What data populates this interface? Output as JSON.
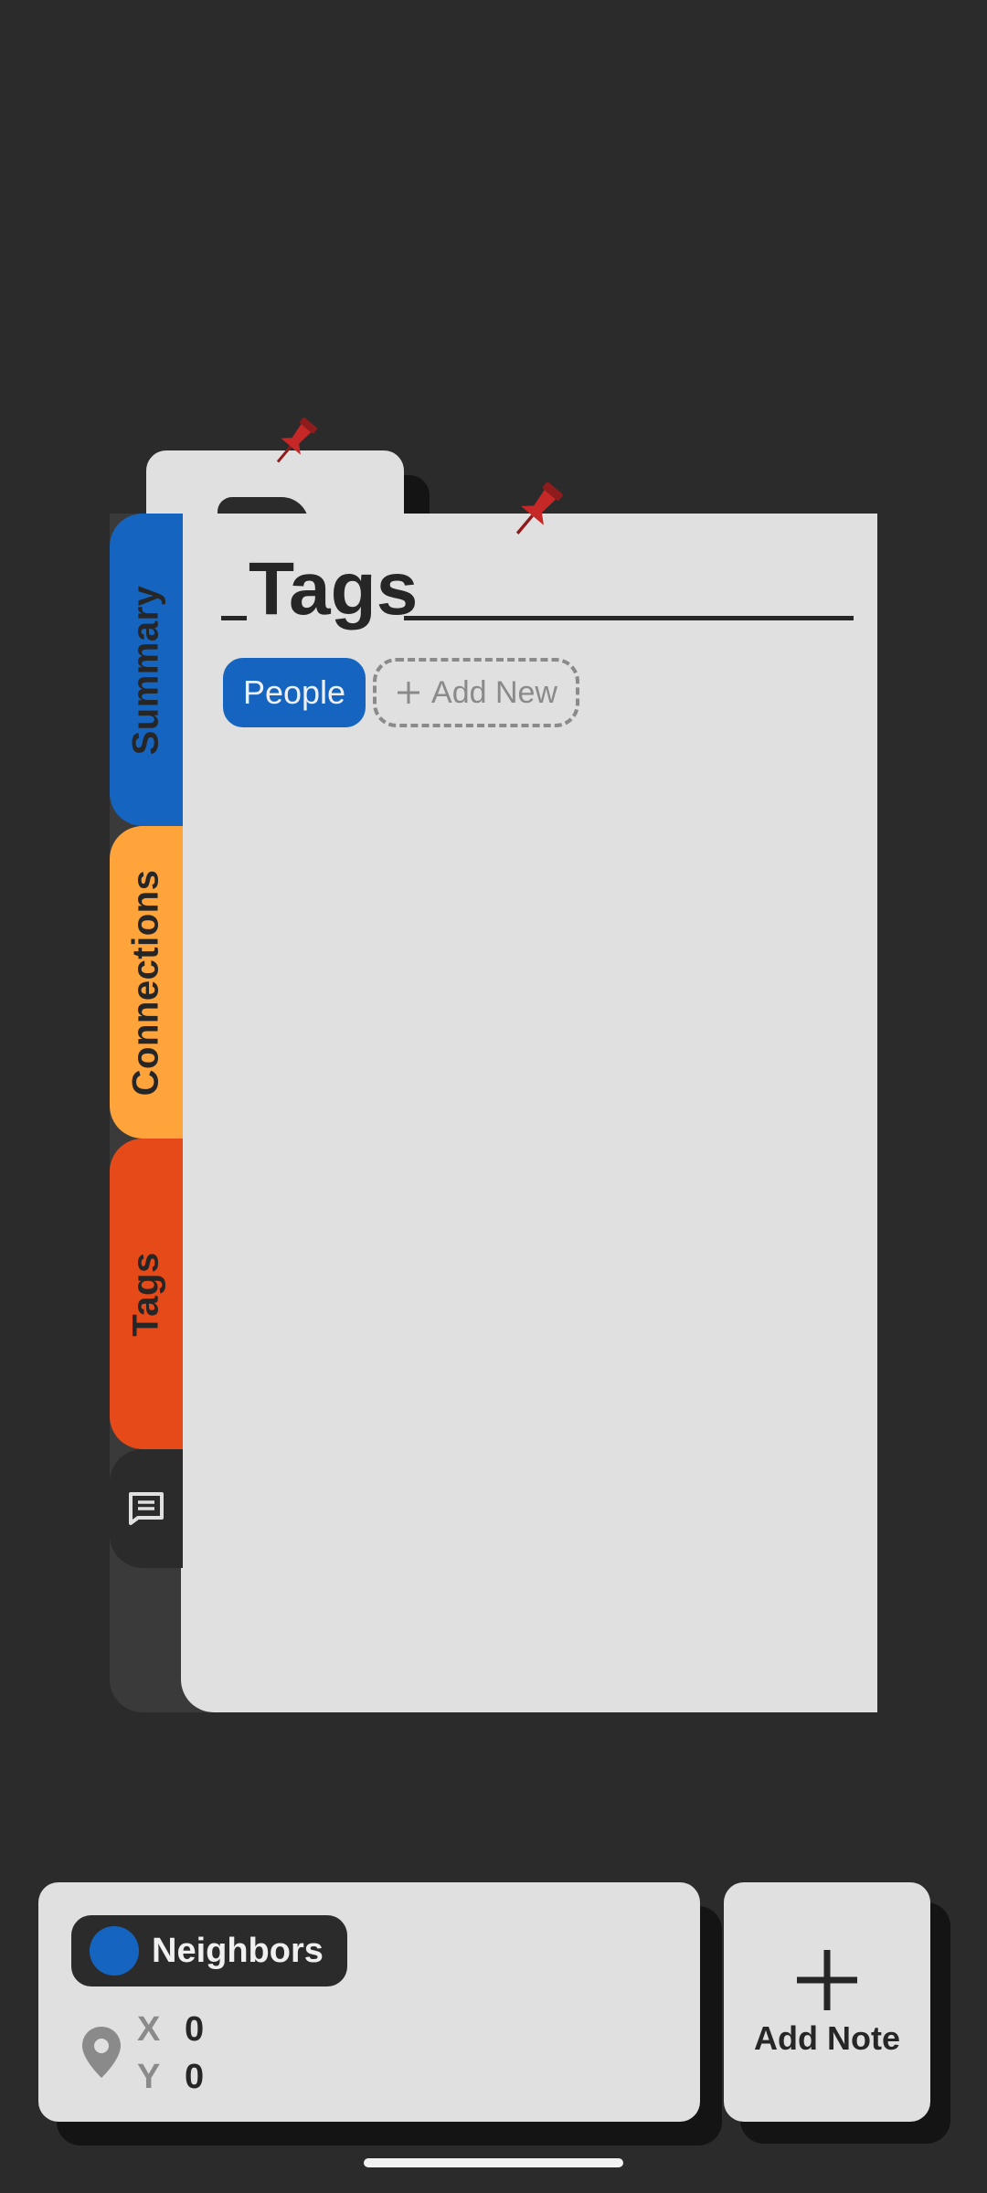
{
  "side_tabs": [
    {
      "label": "Summary"
    },
    {
      "label": "Connections"
    },
    {
      "label": "Tags"
    }
  ],
  "card": {
    "title": "Tags"
  },
  "tags": {
    "chips": [
      "People"
    ],
    "add_new_label": "Add New"
  },
  "location": {
    "group_label": "Neighbors",
    "x_label": "X",
    "x_value": "0",
    "y_label": "Y",
    "y_value": "0"
  },
  "add_note": {
    "label": "Add Note"
  },
  "colors": {
    "background": "#2b2b2b",
    "card": "#e0e0e0",
    "summary_tab": "#1565c0",
    "connections_tab": "#ffa33b",
    "tags_tab": "#e64a19",
    "pin": "#c62828"
  },
  "icons": [
    "pushpin-icon",
    "notes-list-icon",
    "plus-icon",
    "location-pin-icon"
  ]
}
